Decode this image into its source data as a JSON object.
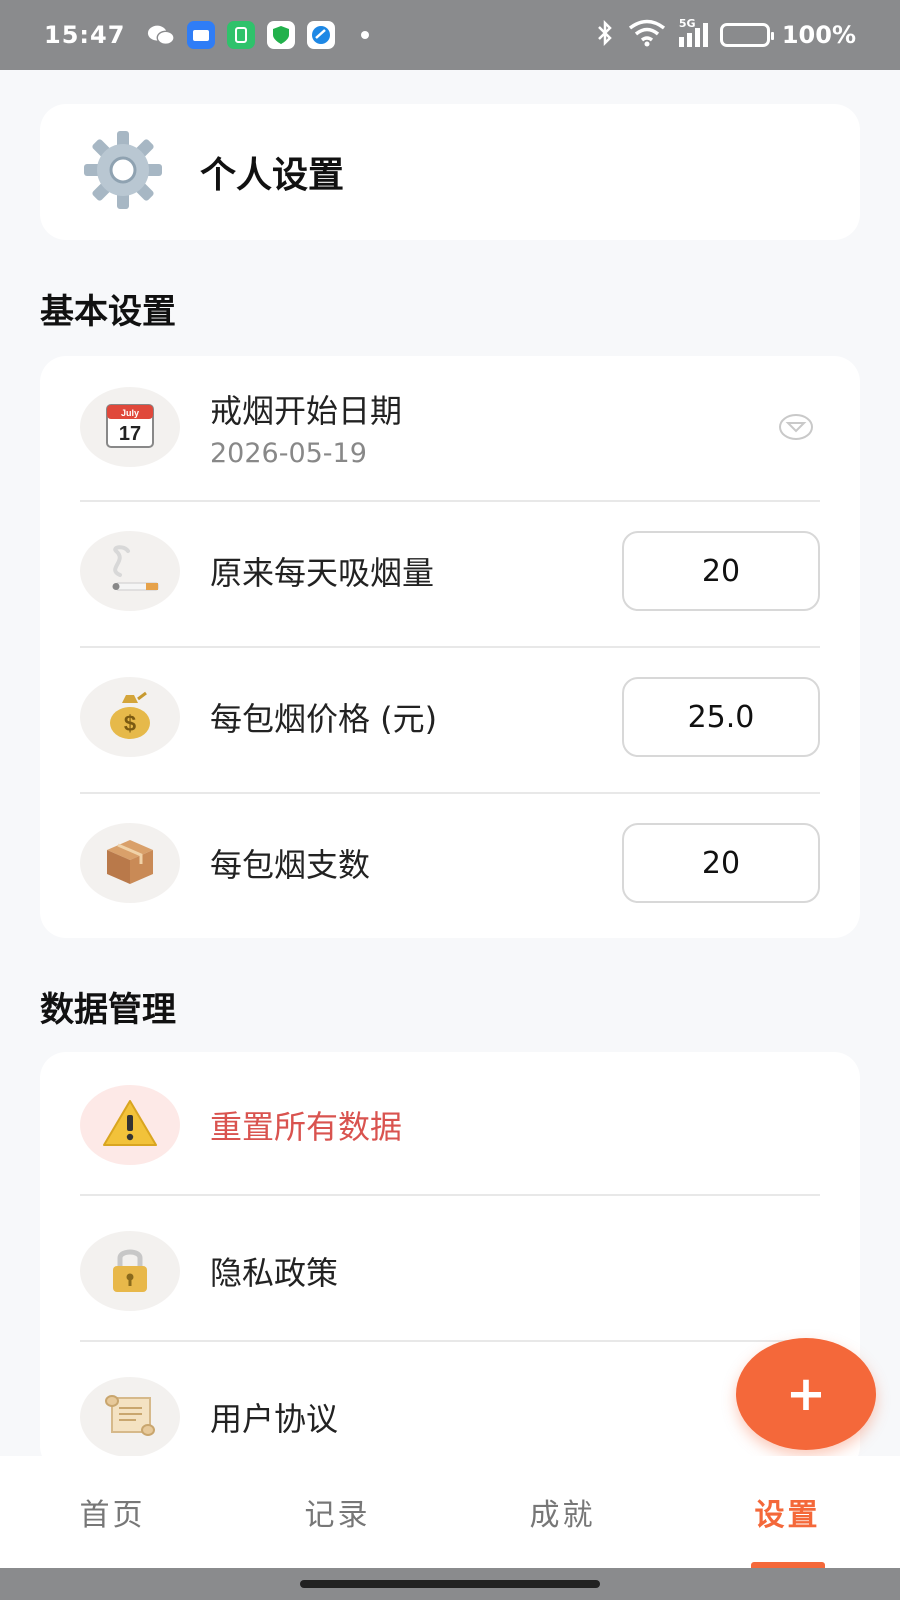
{
  "status_bar": {
    "time": "15:47",
    "network": "5G",
    "battery": "100%",
    "apps": [
      "wechat-icon",
      "folder-app-icon",
      "green-app-icon",
      "shield-app-icon",
      "blue-app-icon"
    ]
  },
  "header": {
    "icon": "gear-icon",
    "title": "个人设置"
  },
  "basic_settings": {
    "section_title": "基本设置",
    "quit_date": {
      "icon": "calendar-icon",
      "calendar_month": "July",
      "calendar_day": "17",
      "label": "戒烟开始日期",
      "value": "2026-05-19"
    },
    "daily_cigarettes": {
      "icon": "cigarette-icon",
      "label": "原来每天吸烟量",
      "value": "20"
    },
    "pack_price": {
      "icon": "money-bag-icon",
      "label": "每包烟价格 (元)",
      "value": "25.0"
    },
    "pack_count": {
      "icon": "package-icon",
      "label": "每包烟支数",
      "value": "20"
    }
  },
  "data_management": {
    "section_title": "数据管理",
    "reset": {
      "icon": "warning-icon",
      "label": "重置所有数据"
    },
    "privacy": {
      "icon": "lock-icon",
      "label": "隐私政策"
    },
    "agreement": {
      "icon": "scroll-icon",
      "label": "用户协议"
    }
  },
  "fab": {
    "label": "+"
  },
  "nav": {
    "items": [
      "首页",
      "记录",
      "成就",
      "设置"
    ],
    "active": "设置"
  },
  "colors": {
    "accent": "#f4683a",
    "danger": "#d9534f",
    "status_bar": "#8a8b8d"
  }
}
